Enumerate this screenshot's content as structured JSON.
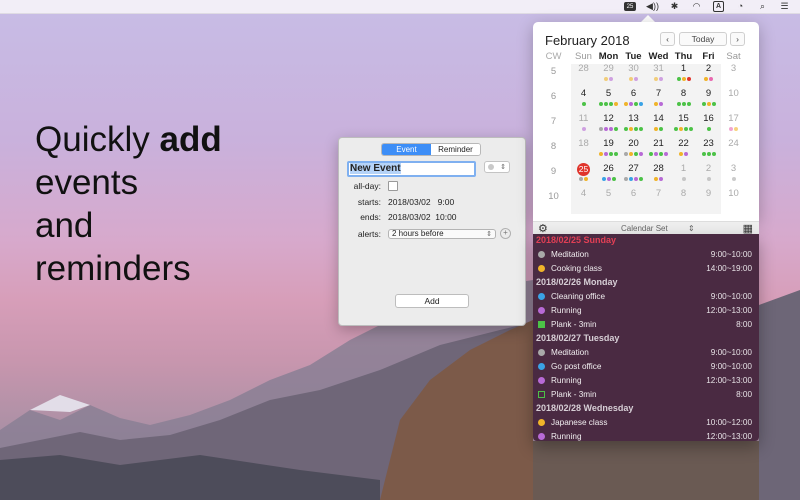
{
  "hero": {
    "line1_prefix": "Quickly",
    "line1_bold": "add",
    "line2": "events",
    "line3": "and",
    "line4": "reminders"
  },
  "dialog": {
    "tabs": [
      "Event",
      "Reminder"
    ],
    "title_value": "New Event",
    "allday_label": "all-day:",
    "starts_label": "starts:",
    "starts_value": "2018/03/02   9:00",
    "ends_label": "ends:",
    "ends_value": "2018/03/02  10:00",
    "alerts_label": "alerts:",
    "alerts_value": "2 hours before",
    "add_label": "Add"
  },
  "calendar": {
    "title": "February 2018",
    "today_label": "Today",
    "prev": "‹",
    "next": "›",
    "cw_header": "CW",
    "weekdays": [
      "Sun",
      "Mon",
      "Tue",
      "Wed",
      "Thu",
      "Fri",
      "Sat"
    ],
    "week_numbers": [
      "5",
      "6",
      "7",
      "8",
      "9",
      "10"
    ],
    "weeks": [
      [
        {
          "d": "28",
          "m": 0
        },
        {
          "d": "29",
          "m": 0
        },
        {
          "d": "30",
          "m": 0
        },
        {
          "d": "31",
          "m": 0
        },
        {
          "d": "1",
          "m": 1
        },
        {
          "d": "2",
          "m": 1
        },
        {
          "d": "3",
          "m": 0
        }
      ],
      [
        {
          "d": "4",
          "m": 1
        },
        {
          "d": "5",
          "m": 1
        },
        {
          "d": "6",
          "m": 1
        },
        {
          "d": "7",
          "m": 1
        },
        {
          "d": "8",
          "m": 1
        },
        {
          "d": "9",
          "m": 1
        },
        {
          "d": "10",
          "m": 0
        }
      ],
      [
        {
          "d": "11",
          "m": 0
        },
        {
          "d": "12",
          "m": 1
        },
        {
          "d": "13",
          "m": 1
        },
        {
          "d": "14",
          "m": 1
        },
        {
          "d": "15",
          "m": 1
        },
        {
          "d": "16",
          "m": 1
        },
        {
          "d": "17",
          "m": 0
        }
      ],
      [
        {
          "d": "18",
          "m": 0
        },
        {
          "d": "19",
          "m": 1
        },
        {
          "d": "20",
          "m": 1
        },
        {
          "d": "21",
          "m": 1
        },
        {
          "d": "22",
          "m": 1
        },
        {
          "d": "23",
          "m": 1
        },
        {
          "d": "24",
          "m": 0
        }
      ],
      [
        {
          "d": "25",
          "m": 1
        },
        {
          "d": "26",
          "m": 1
        },
        {
          "d": "27",
          "m": 1
        },
        {
          "d": "28",
          "m": 1
        },
        {
          "d": "1",
          "m": 0
        },
        {
          "d": "2",
          "m": 0
        },
        {
          "d": "3",
          "m": 0
        }
      ],
      [
        {
          "d": "4",
          "m": 0
        },
        {
          "d": "5",
          "m": 0
        },
        {
          "d": "6",
          "m": 0
        },
        {
          "d": "7",
          "m": 0
        },
        {
          "d": "8",
          "m": 0
        },
        {
          "d": "9",
          "m": 0
        },
        {
          "d": "10",
          "m": 0
        }
      ]
    ],
    "today": "25",
    "calendar_set_label": "Calendar Set"
  },
  "events": {
    "groups": [
      {
        "date": "2018/02/25 Sunday",
        "items": [
          {
            "name": "Meditation",
            "time": "9:00~10:00",
            "color": "#a9a9a9",
            "shape": "dot"
          },
          {
            "name": "Cooking class",
            "time": "14:00~19:00",
            "color": "#f0b42a",
            "shape": "dot"
          }
        ]
      },
      {
        "date": "2018/02/26 Monday",
        "items": [
          {
            "name": "Cleaning office",
            "time": "9:00~10:00",
            "color": "#3aa3e6",
            "shape": "dot"
          },
          {
            "name": "Running",
            "time": "12:00~13:00",
            "color": "#b86ad6",
            "shape": "dot"
          },
          {
            "name": "Plank - 3min",
            "time": "8:00",
            "color": "#4cc247",
            "shape": "square"
          }
        ]
      },
      {
        "date": "2018/02/27 Tuesday",
        "items": [
          {
            "name": "Meditation",
            "time": "9:00~10:00",
            "color": "#a9a9a9",
            "shape": "dot"
          },
          {
            "name": "Go post office",
            "time": "9:00~10:00",
            "color": "#3aa3e6",
            "shape": "dot"
          },
          {
            "name": "Running",
            "time": "12:00~13:00",
            "color": "#b86ad6",
            "shape": "dot"
          },
          {
            "name": "Plank - 3min",
            "time": "8:00",
            "color": "#4cc247",
            "shape": "square-outline"
          }
        ]
      },
      {
        "date": "2018/02/28 Wednesday",
        "items": [
          {
            "name": "Japanese class",
            "time": "10:00~12:00",
            "color": "#f0b42a",
            "shape": "dot"
          },
          {
            "name": "Running",
            "time": "12:00~13:00",
            "color": "#b86ad6",
            "shape": "dot"
          }
        ]
      }
    ]
  },
  "colors": {
    "green": "#4cc247",
    "orange": "#f0b42a",
    "purple": "#b86ad6",
    "blue": "#3aa3e6",
    "grey": "#a9a9a9",
    "pink": "#e86ab0",
    "red": "#e0342b"
  }
}
